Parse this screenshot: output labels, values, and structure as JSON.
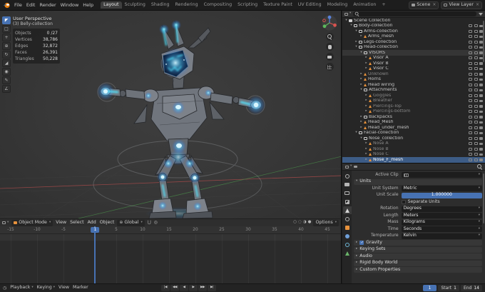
{
  "topbar": {
    "menus": [
      "File",
      "Edit",
      "Render",
      "Window",
      "Help"
    ],
    "workspaces": [
      "Layout",
      "Sculpting",
      "Shading",
      "Rendering",
      "Compositing",
      "Scripting",
      "Texture Paint",
      "UV Editing",
      "Modeling",
      "Animation",
      "+"
    ],
    "active_workspace": "Layout",
    "scene_label": "Scene",
    "view_layer_label": "View Layer"
  },
  "viewport": {
    "overlay": {
      "perspective": "User Perspective",
      "collection": "(3) Belly-collection",
      "stats": [
        {
          "label": "Objects",
          "value": "0 /27"
        },
        {
          "label": "Vertices",
          "value": "38,786"
        },
        {
          "label": "Edges",
          "value": "32,872"
        },
        {
          "label": "Faces",
          "value": "26,391"
        },
        {
          "label": "Triangles",
          "value": "50,228"
        }
      ]
    },
    "header": {
      "mode": "Object Mode",
      "menus": [
        "View",
        "Select",
        "Add",
        "Object"
      ],
      "orientation": "Global",
      "options_label": "Options"
    },
    "tools": [
      "tweak-select",
      "select-box",
      "cursor",
      "move",
      "rotate",
      "scale",
      "transform",
      "annotate",
      "measure"
    ],
    "shading_modes": [
      "wireframe",
      "solid",
      "material-preview",
      "rendered"
    ],
    "gizmo_buttons": [
      "zoom",
      "pan",
      "camera-view",
      "toggle-grid"
    ]
  },
  "outliner": {
    "rows": [
      {
        "depth": 0,
        "arrow": "▾",
        "icon": "scene",
        "label": "Scene Collection",
        "noicons": true
      },
      {
        "depth": 1,
        "arrow": "▾",
        "icon": "collection",
        "label": "Body-collection"
      },
      {
        "depth": 2,
        "arrow": "▾",
        "icon": "collection",
        "label": "Arms-collection"
      },
      {
        "depth": 3,
        "arrow": "▸",
        "icon": "mesh",
        "label": "Arms_mesh"
      },
      {
        "depth": 2,
        "arrow": "▸",
        "icon": "collection",
        "label": "Legs-collection"
      },
      {
        "depth": 2,
        "arrow": "▾",
        "icon": "collection",
        "label": "Head-collection"
      },
      {
        "depth": 3,
        "arrow": "▾",
        "icon": "collection",
        "label": "VISORS",
        "highlight": "soft"
      },
      {
        "depth": 4,
        "arrow": "▸",
        "icon": "mesh",
        "label": "Visor A"
      },
      {
        "depth": 4,
        "arrow": "▸",
        "icon": "mesh",
        "label": "Visor B"
      },
      {
        "depth": 4,
        "arrow": "▸",
        "icon": "mesh",
        "label": "Visor C"
      },
      {
        "depth": 3,
        "arrow": "▸",
        "icon": "mesh",
        "label": "Unknown",
        "muted": true
      },
      {
        "depth": 3,
        "arrow": "▸",
        "icon": "mesh",
        "label": "Horns"
      },
      {
        "depth": 3,
        "arrow": "▸",
        "icon": "mesh",
        "label": "Head wiring"
      },
      {
        "depth": 3,
        "arrow": "▾",
        "icon": "collection",
        "label": "Attachments"
      },
      {
        "depth": 4,
        "arrow": "▸",
        "icon": "mesh",
        "label": "Goggles",
        "muted": true
      },
      {
        "depth": 4,
        "arrow": "▸",
        "icon": "mesh",
        "label": "Breather",
        "muted": true
      },
      {
        "depth": 4,
        "arrow": "▸",
        "icon": "mesh",
        "label": "Piercings-Top",
        "muted": true
      },
      {
        "depth": 4,
        "arrow": "▸",
        "icon": "mesh",
        "label": "Piercings-bottom",
        "muted": true
      },
      {
        "depth": 3,
        "arrow": "▸",
        "icon": "collection",
        "label": "Backpacks"
      },
      {
        "depth": 3,
        "arrow": "▸",
        "icon": "mesh",
        "label": "Head_Mesh"
      },
      {
        "depth": 3,
        "arrow": "▸",
        "icon": "mesh",
        "label": "Head_under_mesh"
      },
      {
        "depth": 2,
        "arrow": "▾",
        "icon": "collection",
        "label": "Facial-collection"
      },
      {
        "depth": 3,
        "arrow": "▾",
        "icon": "collection",
        "label": "Nose_collection"
      },
      {
        "depth": 4,
        "arrow": "▸",
        "icon": "mesh",
        "label": "Nose A",
        "muted": true
      },
      {
        "depth": 4,
        "arrow": "▸",
        "icon": "mesh",
        "label": "Nose B",
        "muted": true
      },
      {
        "depth": 4,
        "arrow": "▸",
        "icon": "mesh",
        "label": "Nose C",
        "muted": true
      },
      {
        "depth": 4,
        "arrow": "▸",
        "icon": "mesh",
        "label": "Nose_F_mesh",
        "selected": true
      }
    ]
  },
  "properties": {
    "tabs": [
      {
        "name": "tool"
      },
      {
        "name": "render"
      },
      {
        "name": "output"
      },
      {
        "name": "view-layer"
      },
      {
        "name": "scene",
        "active": true
      },
      {
        "name": "world"
      },
      {
        "name": "object"
      },
      {
        "name": "modifiers"
      },
      {
        "name": "physics"
      },
      {
        "name": "object-data"
      }
    ],
    "active_clip_label": "Active Clip",
    "units": {
      "title": "Units",
      "rows": [
        {
          "label": "Unit System",
          "value": "Metric",
          "type": "dropdown"
        },
        {
          "label": "Unit Scale",
          "value": "1.000000",
          "type": "slider"
        },
        {
          "label": "",
          "value": "Separate Units",
          "type": "checkbox"
        },
        {
          "label": "Rotation",
          "value": "Degrees",
          "type": "dropdown"
        },
        {
          "label": "Length",
          "value": "Meters",
          "type": "dropdown"
        },
        {
          "label": "Mass",
          "value": "Kilograms",
          "type": "dropdown"
        },
        {
          "label": "Time",
          "value": "Seconds",
          "type": "dropdown"
        },
        {
          "label": "Temperature",
          "value": "Kelvin",
          "type": "dropdown"
        }
      ]
    },
    "sections": [
      {
        "label": "Gravity",
        "checkbox": true
      },
      {
        "label": "Keying Sets"
      },
      {
        "label": "Audio"
      },
      {
        "label": "Rigid Body World"
      },
      {
        "label": "Custom Properties"
      }
    ]
  },
  "timeline": {
    "tick_frames": [
      -15,
      -10,
      -5,
      5,
      10,
      15,
      20,
      25,
      30,
      35,
      40,
      45
    ],
    "current_frame": "1",
    "menus": [
      {
        "label": "Playback",
        "dropdown": true
      },
      {
        "label": "Keying",
        "dropdown": true
      },
      {
        "label": "View"
      },
      {
        "label": "Marker"
      }
    ],
    "transport": [
      "jump-to-start",
      "jump-to-prev-keyframe",
      "play-reverse",
      "play",
      "jump-to-next-keyframe",
      "jump-to-end"
    ],
    "start_label": "Start",
    "start_value": "1",
    "end_label": "End",
    "end_value": "14"
  },
  "colors": {
    "accent": "#4772b3",
    "object_orange": "#e8923c",
    "glow": "#52e5ff"
  }
}
